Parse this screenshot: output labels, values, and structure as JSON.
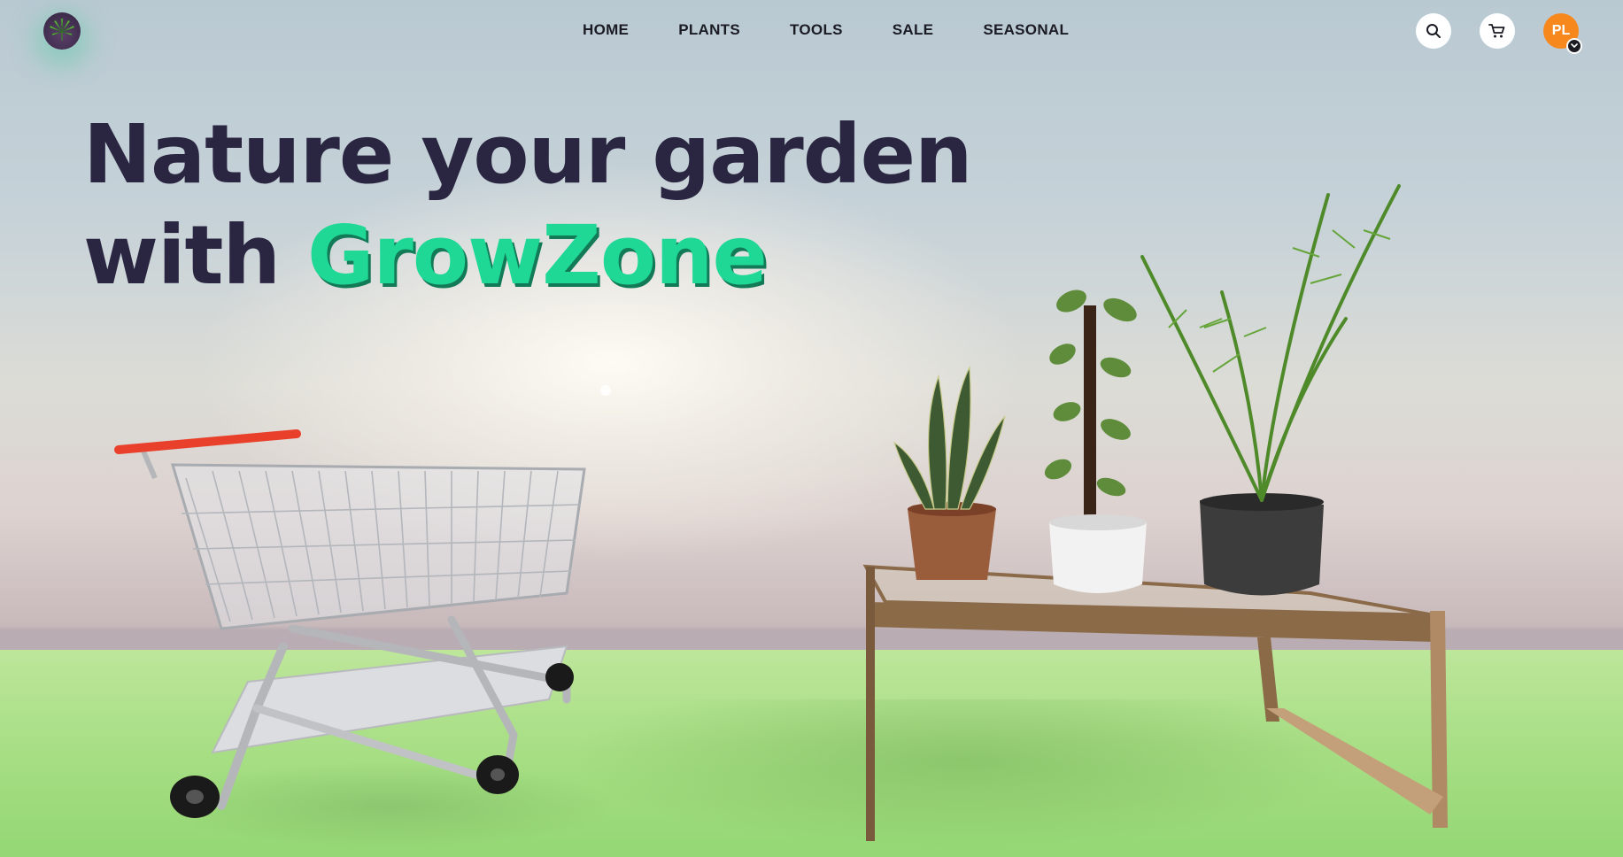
{
  "header": {
    "logo_icon": "cannabis-leaf-logo-icon",
    "nav": [
      {
        "label": "HOME"
      },
      {
        "label": "PLANTS"
      },
      {
        "label": "TOOLS"
      },
      {
        "label": "SALE"
      },
      {
        "label": "SEASONAL"
      }
    ],
    "actions": {
      "search_icon": "search-icon",
      "cart_icon": "cart-icon",
      "avatar_initials": "PL",
      "avatar_menu_icon": "chevron-down-icon"
    }
  },
  "hero": {
    "title_line1": "Nature your garden",
    "title_line2_prefix": "with",
    "brand_name": "GrowZone"
  },
  "scene": {
    "left_object": "shopping-cart-illustration",
    "right_object": "plant-table-illustration"
  },
  "colors": {
    "brand_accent": "#1fd896",
    "headline": "#2a2541",
    "avatar_bg": "#f7881e",
    "floor": "#a9df86"
  }
}
